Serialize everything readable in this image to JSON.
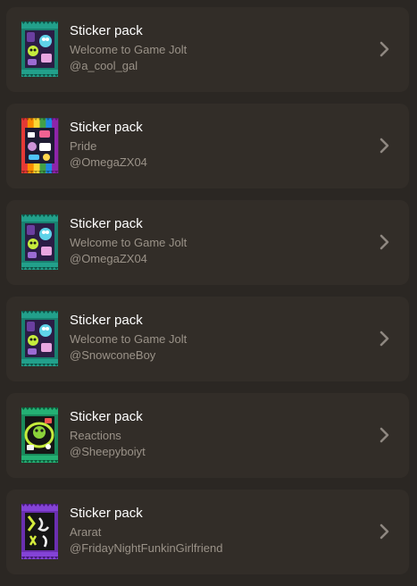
{
  "packs": [
    {
      "title": "Sticker pack",
      "name": "Welcome to Game Jolt",
      "author": "@a_cool_gal",
      "style": "welcome",
      "icon": "sticker-pack-welcome-icon"
    },
    {
      "title": "Sticker pack",
      "name": "Pride",
      "author": "@OmegaZX04",
      "style": "pride",
      "icon": "sticker-pack-pride-icon"
    },
    {
      "title": "Sticker pack",
      "name": "Welcome to Game Jolt",
      "author": "@OmegaZX04",
      "style": "welcome",
      "icon": "sticker-pack-welcome-icon"
    },
    {
      "title": "Sticker pack",
      "name": "Welcome to Game Jolt",
      "author": "@SnowconeBoy",
      "style": "welcome",
      "icon": "sticker-pack-welcome-icon"
    },
    {
      "title": "Sticker pack",
      "name": "Reactions",
      "author": "@Sheepyboiyt",
      "style": "reactions",
      "icon": "sticker-pack-reactions-icon"
    },
    {
      "title": "Sticker pack",
      "name": "Ararat",
      "author": "@FridayNightFunkinGirlfriend",
      "style": "ararat",
      "icon": "sticker-pack-ararat-icon"
    }
  ],
  "colors": {
    "background": "#2b2723",
    "card": "#322d28",
    "title": "#ffffff",
    "subtext": "#9a9288",
    "chevron": "#8e8780"
  },
  "chevron_icon": "chevron-right-icon"
}
